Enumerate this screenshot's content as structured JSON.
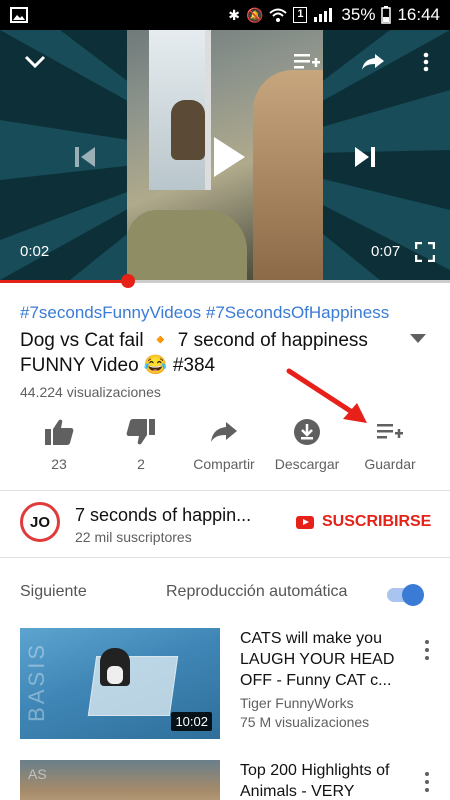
{
  "status_bar": {
    "battery": "35%",
    "time": "16:44",
    "notification_count": "1"
  },
  "player": {
    "current_time": "0:02",
    "duration": "0:07",
    "progress": 0.285
  },
  "video": {
    "hashtags": "#7secondsFunnyVideos #7SecondsOfHappiness",
    "title": "Dog vs Cat fail 🔸 7 second of happiness FUNNY Video 😂 #384",
    "views": "44.224 visualizaciones"
  },
  "actions": [
    {
      "label": "23",
      "icon": "thumbs-up-icon"
    },
    {
      "label": "2",
      "icon": "thumbs-down-icon"
    },
    {
      "label": "Compartir",
      "icon": "share-icon"
    },
    {
      "label": "Descargar",
      "icon": "download-icon"
    },
    {
      "label": "Guardar",
      "icon": "playlist-add-icon"
    }
  ],
  "channel": {
    "avatar_text": "JO",
    "name": "7 seconds of happin...",
    "subscribers": "22 mil suscriptores",
    "subscribe_label": "SUSCRIBIRSE"
  },
  "up_next": {
    "label": "Siguiente",
    "autoplay_label": "Reproducción automática",
    "autoplay_on": true
  },
  "recommended": [
    {
      "title": "CATS will make you LAUGH YOUR HEAD OFF - Funny CAT c...",
      "channel": "Tiger FunnyWorks",
      "views": "75 M visualizaciones",
      "duration": "10:02",
      "thumb_watermark": "BASIS"
    },
    {
      "title": "Top 200 Highlights of Animals - VERY",
      "thumb_watermark": "AS"
    }
  ],
  "colors": {
    "accent_red": "#e62117",
    "link_blue": "#3a7bd5",
    "annotation_arrow": "#e8201a"
  }
}
